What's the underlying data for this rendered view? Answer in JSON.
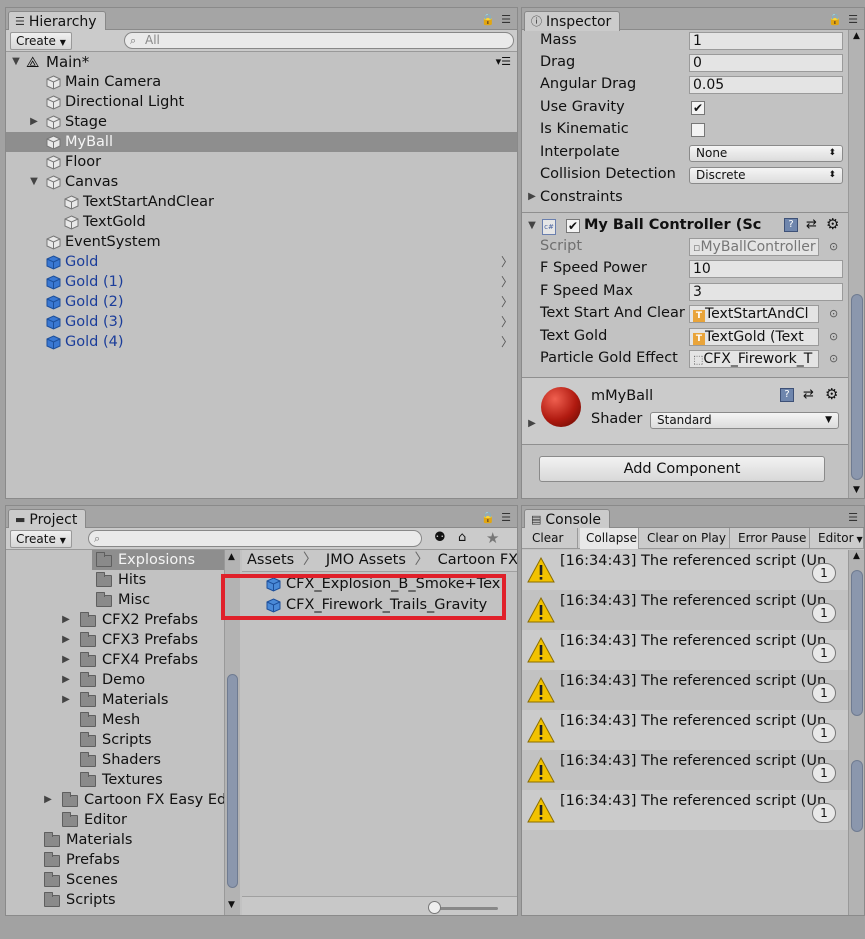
{
  "hierarchy": {
    "tab": "Hierarchy",
    "create": "Create",
    "search_placeholder": "All",
    "scene": "Main*",
    "items": [
      {
        "label": "Main Camera"
      },
      {
        "label": "Directional Light"
      },
      {
        "label": "Stage"
      },
      {
        "label": "MyBall"
      },
      {
        "label": "Floor"
      },
      {
        "label": "Canvas"
      },
      {
        "label": "TextStartAndClear"
      },
      {
        "label": "TextGold"
      },
      {
        "label": "EventSystem"
      },
      {
        "label": "Gold"
      },
      {
        "label": "Gold (1)"
      },
      {
        "label": "Gold (2)"
      },
      {
        "label": "Gold (3)"
      },
      {
        "label": "Gold (4)"
      }
    ]
  },
  "inspector": {
    "tab": "Inspector",
    "rigidbody": {
      "mass_label": "Mass",
      "mass": "1",
      "drag_label": "Drag",
      "drag": "0",
      "angular_drag_label": "Angular Drag",
      "angular_drag": "0.05",
      "use_gravity_label": "Use Gravity",
      "use_gravity": true,
      "is_kinematic_label": "Is Kinematic",
      "is_kinematic": false,
      "interpolate_label": "Interpolate",
      "interpolate": "None",
      "collision_label": "Collision Detection",
      "collision": "Discrete",
      "constraints_label": "Constraints"
    },
    "script_component": {
      "title": "My Ball Controller (Sc",
      "script_label": "Script",
      "script": "MyBallController",
      "f_speed_power_label": "F Speed Power",
      "f_speed_power": "10",
      "f_speed_max_label": "F Speed Max",
      "f_speed_max": "3",
      "text_start_label": "Text Start And Clear",
      "text_start": "TextStartAndCl",
      "text_gold_label": "Text Gold",
      "text_gold": "TextGold (Text",
      "particle_label": "Particle Gold Effect",
      "particle": "CFX_Firework_T"
    },
    "material": {
      "name": "mMyBall",
      "shader_label": "Shader",
      "shader": "Standard",
      "color": "#b01a10"
    },
    "add_component": "Add Component"
  },
  "project": {
    "tab": "Project",
    "create": "Create",
    "tree": [
      {
        "label": "Explosions"
      },
      {
        "label": "Hits"
      },
      {
        "label": "Misc"
      },
      {
        "label": "CFX2 Prefabs"
      },
      {
        "label": "CFX3 Prefabs"
      },
      {
        "label": "CFX4 Prefabs"
      },
      {
        "label": "Demo"
      },
      {
        "label": "Materials"
      },
      {
        "label": "Mesh"
      },
      {
        "label": "Scripts"
      },
      {
        "label": "Shaders"
      },
      {
        "label": "Textures"
      },
      {
        "label": "Cartoon FX Easy Ed"
      },
      {
        "label": "Editor"
      },
      {
        "label": "Materials"
      },
      {
        "label": "Prefabs"
      },
      {
        "label": "Scenes"
      },
      {
        "label": "Scripts"
      }
    ],
    "breadcrumb": [
      "Assets",
      "JMO Assets",
      "Cartoon FX"
    ],
    "files": [
      {
        "label": "CFX_Explosion_B_Smoke+Tex"
      },
      {
        "label": "CFX_Firework_Trails_Gravity"
      }
    ],
    "highlight_color": "#e0202a"
  },
  "console": {
    "tab": "Console",
    "buttons": [
      "Clear",
      "Collapse",
      "Clear on Play",
      "Error Pause",
      "Editor"
    ],
    "entries": [
      {
        "text": "[16:34:43] The referenced script (Un",
        "count": "1"
      },
      {
        "text": "[16:34:43] The referenced script (Un",
        "count": "1"
      },
      {
        "text": "[16:34:43] The referenced script (Un",
        "count": "1"
      },
      {
        "text": "[16:34:43] The referenced script (Un",
        "count": "1"
      },
      {
        "text": "[16:34:43] The referenced script (Un",
        "count": "1"
      },
      {
        "text": "[16:34:43] The referenced script (Un",
        "count": "1"
      },
      {
        "text": "[16:34:43] The referenced script (Un",
        "count": "1"
      }
    ]
  }
}
